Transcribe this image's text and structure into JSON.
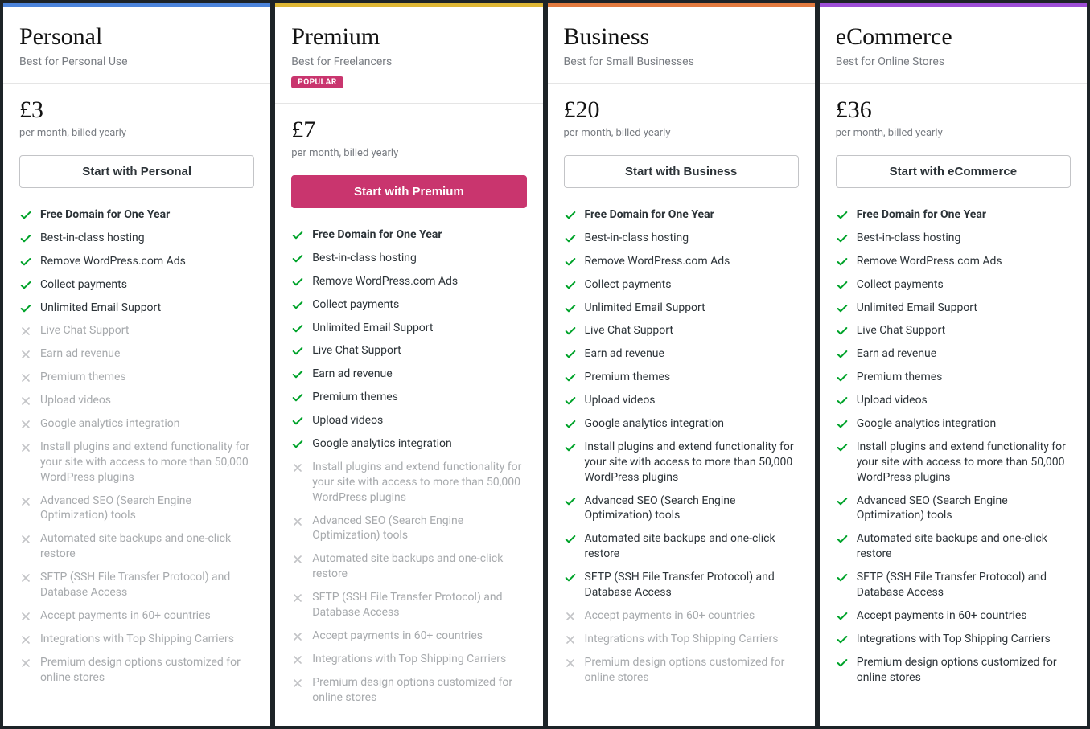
{
  "features": [
    {
      "text": "Free Domain for One Year",
      "bold": true
    },
    {
      "text": "Best-in-class hosting"
    },
    {
      "text": "Remove WordPress.com Ads"
    },
    {
      "text": "Collect payments"
    },
    {
      "text": "Unlimited Email Support"
    },
    {
      "text": "Live Chat Support"
    },
    {
      "text": "Earn ad revenue"
    },
    {
      "text": "Premium themes"
    },
    {
      "text": "Upload videos"
    },
    {
      "text": "Google analytics integration"
    },
    {
      "text": "Install plugins and extend functionality for your site with access to more than 50,000 WordPress plugins"
    },
    {
      "text": "Advanced SEO (Search Engine Optimization) tools"
    },
    {
      "text": "Automated site backups and one-click restore"
    },
    {
      "text": "SFTP (SSH File Transfer Protocol) and Database Access"
    },
    {
      "text": "Accept payments in 60+ countries"
    },
    {
      "text": "Integrations with Top Shipping Carriers"
    },
    {
      "text": "Premium design options customized for online stores"
    }
  ],
  "plans": [
    {
      "key": "personal",
      "name": "Personal",
      "sub": "Best for Personal Use",
      "price": "£3",
      "price_sub": "per month, billed yearly",
      "cta": "Start with Personal",
      "primary": false,
      "badge": "",
      "color": "#4c84db",
      "included": 5
    },
    {
      "key": "premium",
      "name": "Premium",
      "sub": "Best for Freelancers",
      "price": "£7",
      "price_sub": "per month, billed yearly",
      "cta": "Start with Premium",
      "primary": true,
      "badge": "POPULAR",
      "color": "#deb634",
      "included": 10
    },
    {
      "key": "business",
      "name": "Business",
      "sub": "Best for Small Businesses",
      "price": "£20",
      "price_sub": "per month, billed yearly",
      "cta": "Start with Business",
      "primary": false,
      "badge": "",
      "color": "#e27a3f",
      "included": 14
    },
    {
      "key": "ecommerce",
      "name": "eCommerce",
      "sub": "Best for Online Stores",
      "price": "£36",
      "price_sub": "per month, billed yearly",
      "cta": "Start with eCommerce",
      "primary": false,
      "badge": "",
      "color": "#9d4ed6",
      "included": 17
    }
  ]
}
